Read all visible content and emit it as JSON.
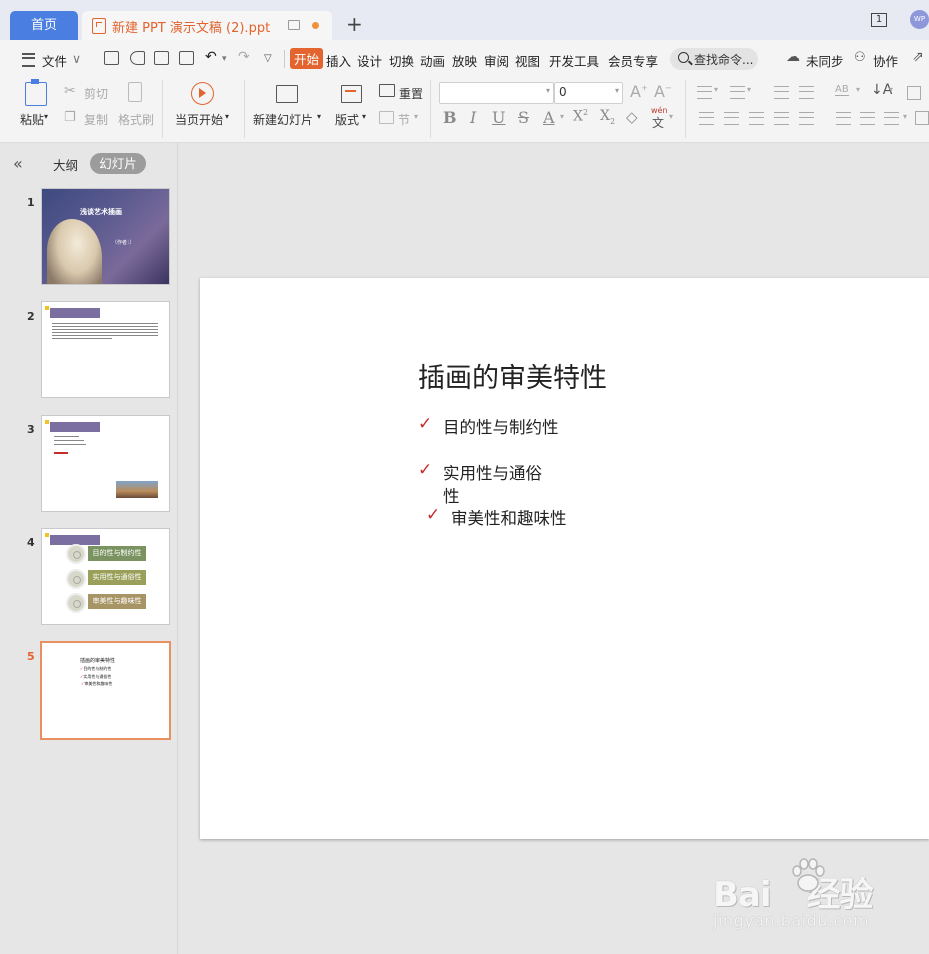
{
  "titlebar": {
    "home_tab": "首页",
    "doc_tab": "新建 PPT 演示文稿 (2).ppt",
    "new_tab_label": "+",
    "window_count": "1",
    "avatar_text": "WP"
  },
  "menubar": {
    "items": [
      "文件",
      "开始",
      "插入",
      "设计",
      "切换",
      "动画",
      "放映",
      "审阅",
      "视图",
      "开发工具",
      "会员专享"
    ],
    "search_placeholder": "查找命令...",
    "sync": "未同步",
    "collab": "协作"
  },
  "ribbon": {
    "paste": "粘贴",
    "cut": "剪切",
    "copy": "复制",
    "format_painter": "格式刷",
    "play_from_current": "当页开始",
    "new_slide": "新建幻灯片",
    "layout": "版式",
    "reset": "重置",
    "section": "节",
    "font_name": "",
    "font_size": "0",
    "pinyin": "wén"
  },
  "left_panel": {
    "tab_outline": "大纲",
    "tab_slides": "幻灯片",
    "slide_numbers": [
      "1",
      "2",
      "3",
      "4",
      "5"
    ],
    "active_slide": "5",
    "thumb1_title": "浅谈艺术插画",
    "thumb1_sub": "（作者：）",
    "thumb4_items": [
      "目的性与制约性",
      "实用性与通俗性",
      "审美性与趣味性"
    ],
    "thumb4_colors": [
      "#7a9360",
      "#9aa05a",
      "#a89566"
    ]
  },
  "slide": {
    "title": "插画的审美特性",
    "bullets": [
      "目的性与制约性",
      "实用性与通俗",
      "性",
      "审美性和趣味性"
    ],
    "check_color": "#c72c2c"
  },
  "watermark": {
    "brand": "Bai",
    "brand2": "经验",
    "url": "jingyan.baidu.com"
  }
}
